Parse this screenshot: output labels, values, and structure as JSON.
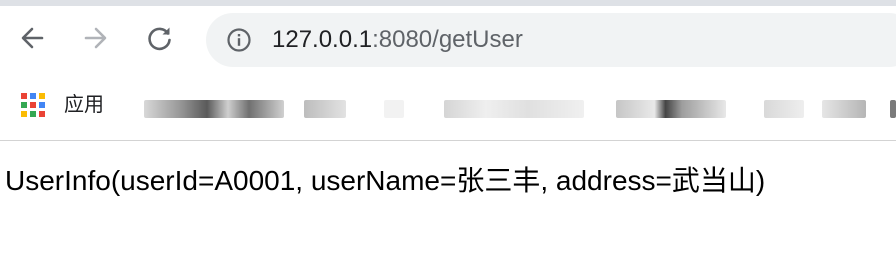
{
  "browser": {
    "nav": {
      "back_icon": "arrow-left-icon",
      "forward_icon": "arrow-right-icon",
      "reload_icon": "reload-icon"
    },
    "omnibox": {
      "info_icon": "info-circle-icon",
      "url_host": "127.0.0.1",
      "url_rest": ":8080/getUser"
    },
    "bookmarks": {
      "apps_icon": "apps-grid-icon",
      "apps_label": "应用"
    }
  },
  "page": {
    "body_text": "UserInfo(userId=A0001, userName=张三丰, address=武当山)"
  },
  "colors": {
    "frame": "#dee1e6",
    "omnibox_bg": "#f1f3f4",
    "icon": "#5f6368",
    "icon_disabled": "#b0b3b8",
    "text": "#202124"
  }
}
